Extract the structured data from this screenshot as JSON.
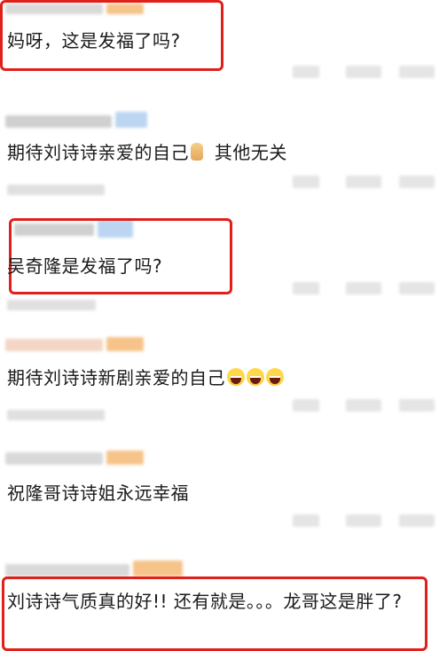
{
  "comments": [
    {
      "text": "妈呀，这是发福了吗?"
    },
    {
      "text_before_emoji": "期待刘诗诗亲爱的自己",
      "text_after_emoji": " 其他无关",
      "emoji": "thumb-up-icon"
    },
    {
      "text": "吴奇隆是发福了吗?"
    },
    {
      "text": "期待刘诗诗新剧亲爱的自己",
      "emoji": "grinning-face-icon",
      "emoji_count": 3
    },
    {
      "text": "祝隆哥诗诗姐永远幸福"
    },
    {
      "text": "刘诗诗气质真的好!! 还有就是。。。龙哥这是胖了?"
    }
  ],
  "colors": {
    "highlight": "#e0201b",
    "text": "#1a1a1a",
    "blur_gray": "#d9d9d9",
    "blur_orange": "#f6c48a",
    "blur_blue": "#bcd6f2"
  }
}
